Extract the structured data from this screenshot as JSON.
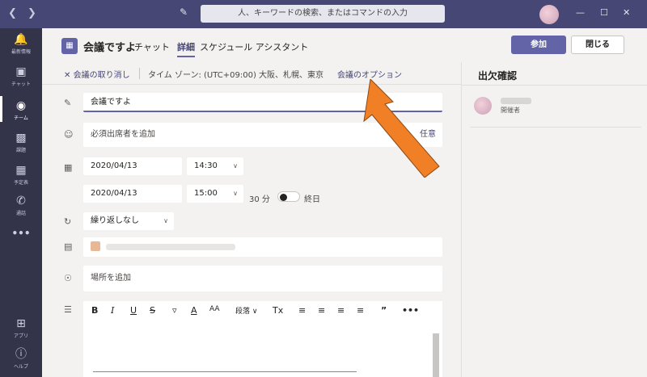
{
  "titlebar": {
    "back_icon": "chevron-left-icon",
    "forward_icon": "chevron-right-icon",
    "search_placeholder": "人、キーワードの検索、またはコマンドの入力"
  },
  "rail": {
    "items": [
      {
        "label": "最新情報",
        "icon": "bell-icon"
      },
      {
        "label": "チャット",
        "icon": "chat-icon"
      },
      {
        "label": "チーム",
        "icon": "teams-icon"
      },
      {
        "label": "課題",
        "icon": "assignments-icon"
      },
      {
        "label": "予定表",
        "icon": "calendar-icon"
      },
      {
        "label": "通話",
        "icon": "phone-icon"
      },
      {
        "label": "•••",
        "icon": "more-icon"
      },
      {
        "label": "アプリ",
        "icon": "apps-icon"
      },
      {
        "label": "ヘルプ",
        "icon": "help-icon"
      }
    ]
  },
  "header": {
    "title": "会議ですよ",
    "tabs": [
      {
        "label": "チャット"
      },
      {
        "label": "詳細"
      },
      {
        "label": "スケジュール アシスタント"
      }
    ],
    "join_label": "参加",
    "close_label": "閉じる"
  },
  "options_bar": {
    "cancel_label": "会議の取り消し",
    "timezone": "タイム ゾーン: (UTC+09:00) 大阪、札幌、東京",
    "meeting_options": "会議のオプション"
  },
  "form": {
    "title_value": "会議ですよ",
    "attendees_placeholder": "必須出席者を追加",
    "optional_label": "任意",
    "start_date": "2020/04/13",
    "start_time": "14:30",
    "end_date": "2020/04/13",
    "end_time": "15:00",
    "duration": "30 分",
    "all_day_label": "終日",
    "repeat_value": "繰り返しなし",
    "location_placeholder": "場所を追加"
  },
  "editor_toolbar": [
    "B",
    "I",
    "U",
    "S",
    "A",
    "A",
    "AA",
    "段落 ∨",
    "Tx",
    "≡",
    "≡",
    "≡",
    "≡",
    "”",
    "•••"
  ],
  "side": {
    "title": "出欠確認",
    "attendee_role": "開催者"
  },
  "accent_color": "#6264a7",
  "annotation_arrow_color": "#f07f26"
}
